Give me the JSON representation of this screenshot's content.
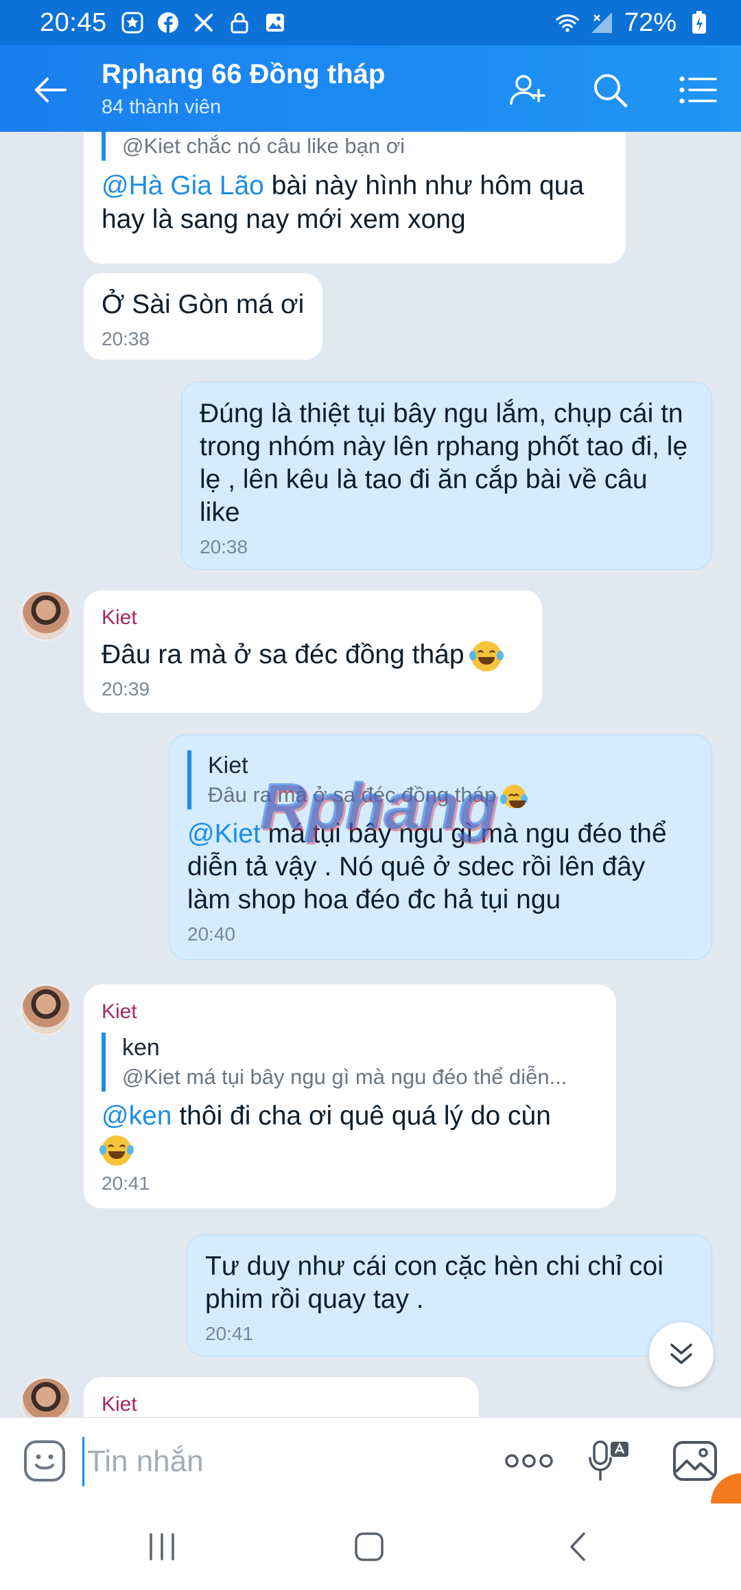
{
  "status_bar": {
    "time": "20:45",
    "battery": "72%",
    "icons": [
      "star-badge-icon",
      "facebook-icon",
      "tools-icon",
      "lock-icon",
      "image-icon"
    ]
  },
  "header": {
    "title": "Rphang 66 Đồng tháp",
    "subtitle": "84 thành viên"
  },
  "messages": [
    {
      "quote_text": "@Kiet chắc nó câu like bạn ơi",
      "mention": "@Hà Gia Lão",
      "text": " bài này hình như hôm qua hay là sang nay mới xem xong"
    },
    {
      "text": "Ở Sài Gòn má ơi",
      "time": "20:38"
    },
    {
      "text": "Đúng là thiệt tụi bây ngu lắm, chụp cái tn trong nhóm này lên rphang phốt tao đi, lẹ lẹ , lên kêu là tao đi ăn cắp bài về câu like",
      "time": "20:38"
    },
    {
      "sender": "Kiet",
      "text": "Đâu ra mà ở sa đéc đồng tháp",
      "time": "20:39"
    },
    {
      "quote_name": "Kiet",
      "quote_text": "Đâu ra mà ở sa đéc đồng tháp",
      "mention": "@Kiet",
      "text": " má tụi bây ngu gì mà ngu đéo thể diễn tả vậy . Nó quê ở sdec rồi lên đây làm shop hoa đéo đc hả tụi ngu",
      "time": "20:40"
    },
    {
      "sender": "Kiet",
      "quote_name": "ken",
      "quote_text": "@Kiet má tụi bây ngu gì mà ngu đéo thể diễn...",
      "mention": "@ken",
      "text": " thôi đi cha ơi quê quá lý do cùn",
      "time": "20:41"
    },
    {
      "text": "Tư duy như cái con cặc hèn chi chỉ coi phim rồi quay tay .",
      "time": "20:41"
    },
    {
      "sender": "Kiet"
    }
  ],
  "watermark": "Rphang",
  "input": {
    "placeholder": "Tin nhắn"
  },
  "colors": {
    "header": "#1d8cf2",
    "status_bar": "#0c72d8",
    "mention": "#1d8ce8",
    "sender": "#a3285f",
    "outgoing_bubble": "#d5ecfe"
  }
}
